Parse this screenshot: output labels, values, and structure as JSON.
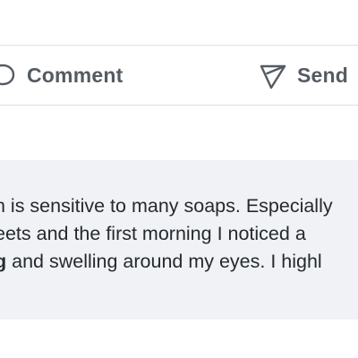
{
  "actions": {
    "comment": {
      "label": "Comment",
      "icon": "comment-bubble-icon"
    },
    "send": {
      "label": "Send",
      "icon": "send-paper-plane-icon"
    }
  },
  "review": {
    "lines": [
      {
        "text": "n is sensitive to many soaps. Especially"
      },
      {
        "text": "eets and the first morning I noticed a"
      },
      {
        "bold": "g",
        "text": " and swelling around my eyes. I highl"
      }
    ]
  },
  "colors": {
    "action_text": "#555b62",
    "divider": "#dcdfe3",
    "review_background": "#f1f2f5",
    "review_text": "#242a30"
  }
}
